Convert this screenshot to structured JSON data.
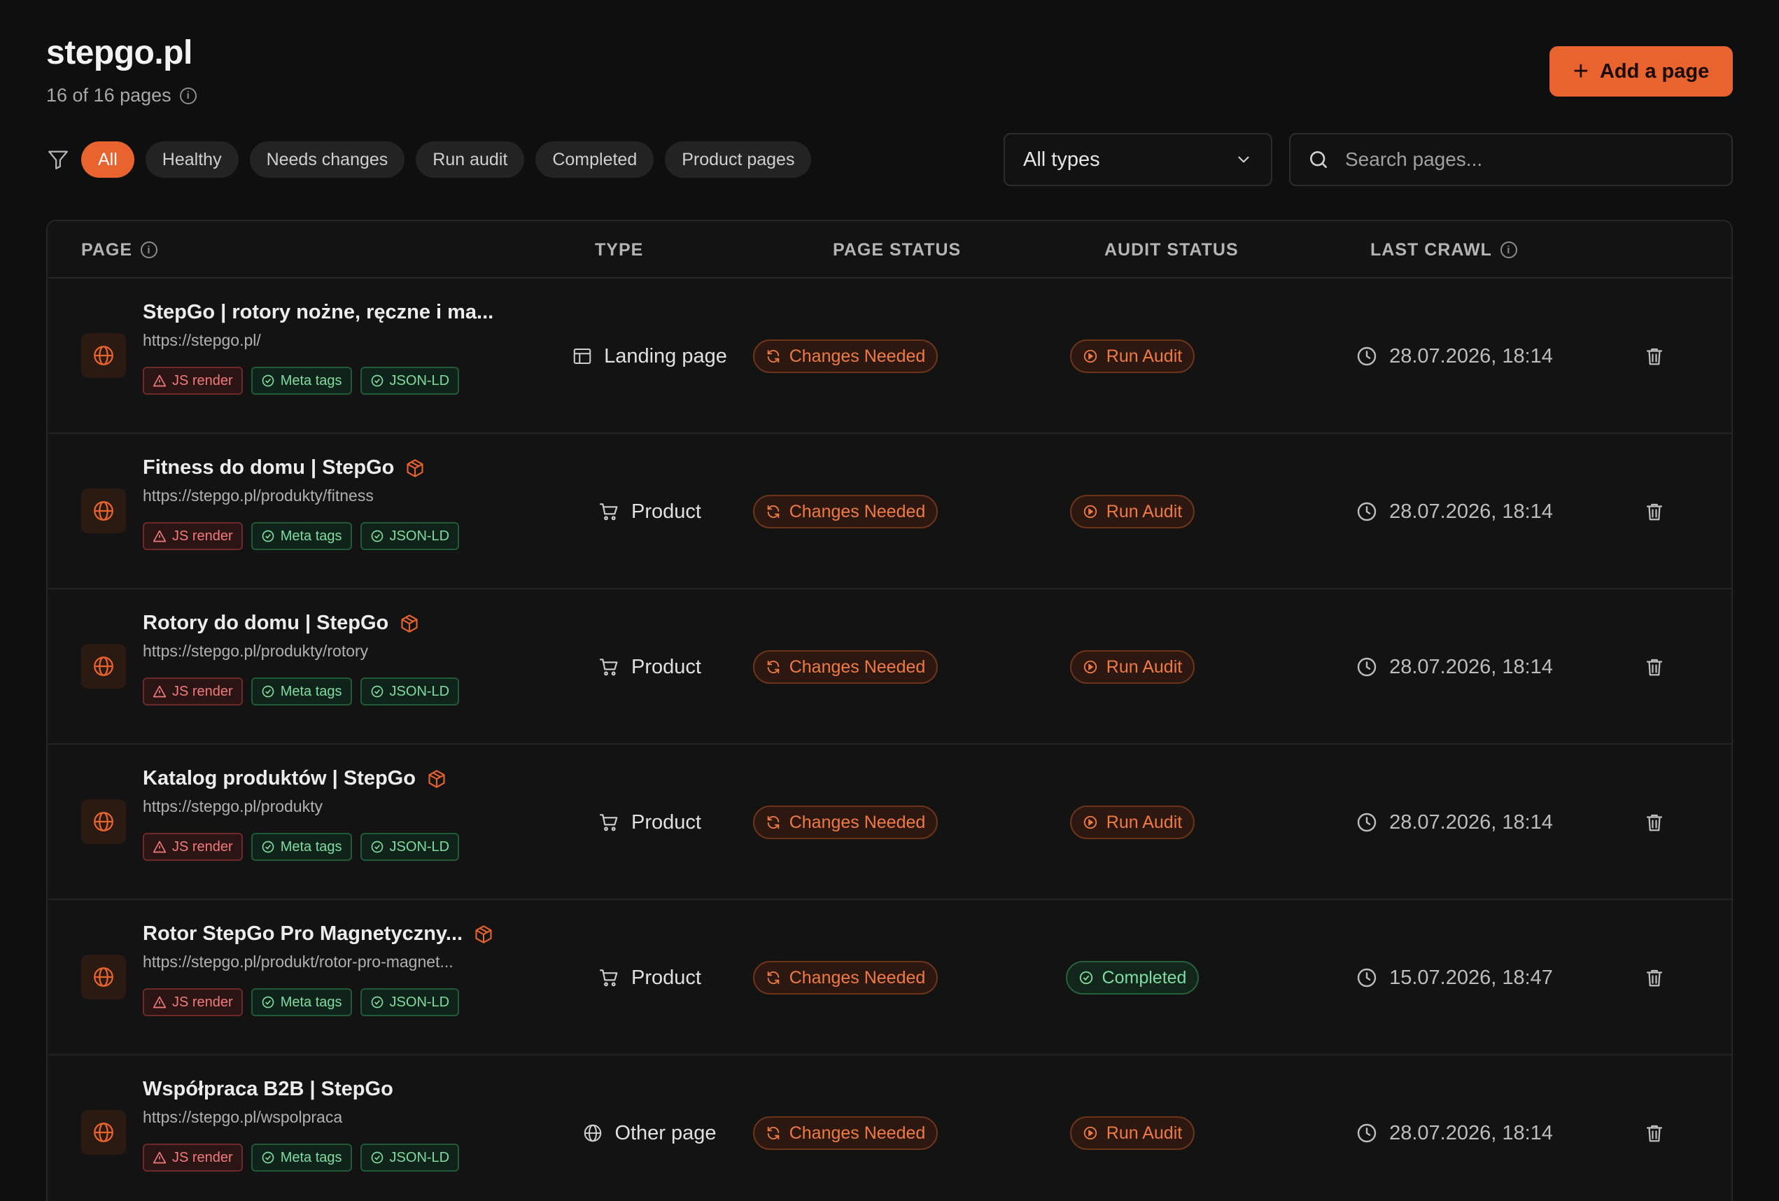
{
  "header": {
    "site": "stepgo.pl",
    "page_count": "16 of 16 pages",
    "add_button": "Add a page"
  },
  "filters": {
    "chips": [
      "All",
      "Healthy",
      "Needs changes",
      "Run audit",
      "Completed",
      "Product pages"
    ],
    "active": "All",
    "type_select": "All types",
    "search_placeholder": "Search pages..."
  },
  "table": {
    "columns": [
      "PAGE",
      "TYPE",
      "PAGE STATUS",
      "AUDIT STATUS",
      "LAST CRAWL"
    ],
    "rows": [
      {
        "title": "StepGo | rotory nożne, ręczne i ma...",
        "url": "https://stepgo.pl/",
        "product_badge": false,
        "tags": [
          "JS render",
          "Meta tags",
          "JSON-LD"
        ],
        "type": "Landing page",
        "type_icon": "layout-icon",
        "page_status": "Changes Needed",
        "audit_status": "Run Audit",
        "audit_variant": "orange",
        "last_crawl": "28.07.2026, 18:14"
      },
      {
        "title": "Fitness do domu | StepGo",
        "url": "https://stepgo.pl/produkty/fitness",
        "product_badge": true,
        "tags": [
          "JS render",
          "Meta tags",
          "JSON-LD"
        ],
        "type": "Product",
        "type_icon": "cart-icon",
        "page_status": "Changes Needed",
        "audit_status": "Run Audit",
        "audit_variant": "orange",
        "last_crawl": "28.07.2026, 18:14"
      },
      {
        "title": "Rotory do domu | StepGo",
        "url": "https://stepgo.pl/produkty/rotory",
        "product_badge": true,
        "tags": [
          "JS render",
          "Meta tags",
          "JSON-LD"
        ],
        "type": "Product",
        "type_icon": "cart-icon",
        "page_status": "Changes Needed",
        "audit_status": "Run Audit",
        "audit_variant": "orange",
        "last_crawl": "28.07.2026, 18:14"
      },
      {
        "title": "Katalog produktów | StepGo",
        "url": "https://stepgo.pl/produkty",
        "product_badge": true,
        "tags": [
          "JS render",
          "Meta tags",
          "JSON-LD"
        ],
        "type": "Product",
        "type_icon": "cart-icon",
        "page_status": "Changes Needed",
        "audit_status": "Run Audit",
        "audit_variant": "orange",
        "last_crawl": "28.07.2026, 18:14"
      },
      {
        "title": "Rotor StepGo Pro Magnetyczny...",
        "url": "https://stepgo.pl/produkt/rotor-pro-magnet...",
        "product_badge": true,
        "tags": [
          "JS render",
          "Meta tags",
          "JSON-LD"
        ],
        "type": "Product",
        "type_icon": "cart-icon",
        "page_status": "Changes Needed",
        "audit_status": "Completed",
        "audit_variant": "green",
        "last_crawl": "15.07.2026, 18:47"
      },
      {
        "title": "Współpraca B2B | StepGo",
        "url": "https://stepgo.pl/wspolpraca",
        "product_badge": false,
        "tags": [
          "JS render",
          "Meta tags",
          "JSON-LD"
        ],
        "type": "Other page",
        "type_icon": "globe-icon",
        "page_status": "Changes Needed",
        "audit_status": "Run Audit",
        "audit_variant": "orange",
        "last_crawl": "28.07.2026, 18:14"
      }
    ]
  },
  "colors": {
    "accent": "#e8632e",
    "background": "#0f0f0f",
    "success": "#7fdca0",
    "danger": "#f27b7b"
  }
}
